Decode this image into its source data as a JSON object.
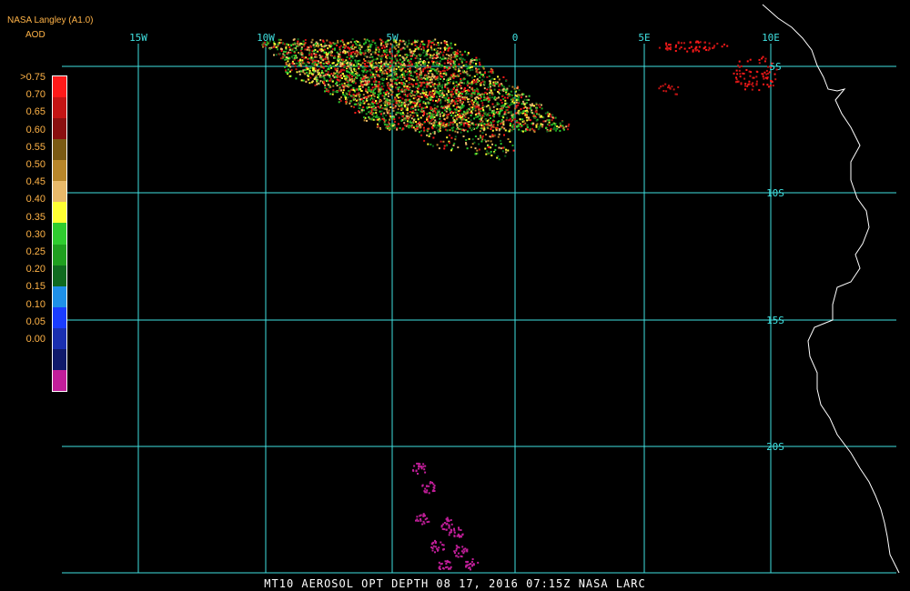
{
  "header": {
    "producer": "NASA Langley (A1.0)",
    "parameter": "AOD"
  },
  "colors": {
    "header_text": "#ffb347",
    "grid": "#40e0e0",
    "coast": "#ffffff"
  },
  "legend": {
    "labels": [
      ">0.75",
      "0.70",
      "0.65",
      "0.60",
      "0.55",
      "0.50",
      "0.45",
      "0.40",
      "0.35",
      "0.30",
      "0.25",
      "0.20",
      "0.15",
      "0.10",
      "0.05",
      "0.00"
    ],
    "swatches": [
      "#ff1a1a",
      "#c41414",
      "#8a0f0f",
      "#7a5a14",
      "#b8862a",
      "#e8b96a",
      "#ffff33",
      "#2fcc2f",
      "#1f9f1f",
      "#0f6a1f",
      "#1e90e8",
      "#1a3cff",
      "#1a2fb0",
      "#101a6a",
      "#c21e9a"
    ]
  },
  "grid": {
    "lon_labels": [
      "15W",
      "10W",
      "5W",
      "0",
      "5E",
      "10E"
    ],
    "lat_labels": [
      "5S",
      "10S",
      "15S",
      "20S"
    ]
  },
  "footer": "MT10  AEROSOL OPT DEPTH   08 17, 2016 07:15Z   NASA LARC"
}
